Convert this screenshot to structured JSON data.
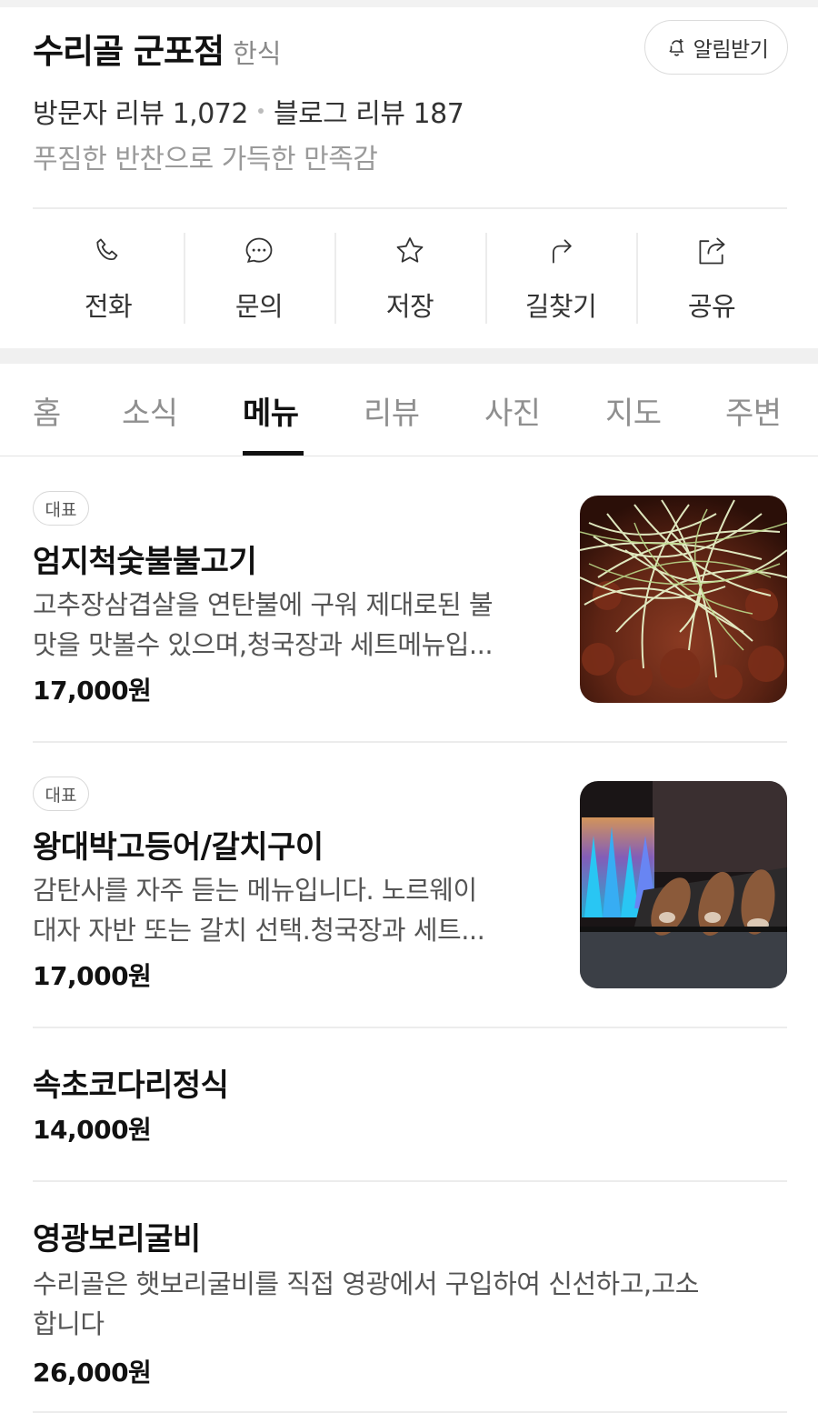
{
  "store": {
    "name": "수리골 군포점",
    "category": "한식",
    "alarm_label": "알림받기",
    "visitor_reviews": "방문자 리뷰 1,072",
    "blog_reviews": "블로그 리뷰 187",
    "tagline": "푸짐한 반찬으로 가득한 만족감"
  },
  "actions": [
    {
      "label": "전화",
      "icon": "phone-icon"
    },
    {
      "label": "문의",
      "icon": "chat-icon"
    },
    {
      "label": "저장",
      "icon": "star-icon"
    },
    {
      "label": "길찾기",
      "icon": "directions-icon"
    },
    {
      "label": "공유",
      "icon": "share-icon"
    }
  ],
  "tabs": [
    "홈",
    "소식",
    "메뉴",
    "리뷰",
    "사진",
    "지도",
    "주변"
  ],
  "active_tab": "메뉴",
  "menu": [
    {
      "badge": "대표",
      "name": "엄지척숯불불고기",
      "desc_line1": "고추장삼겹살을 연탄불에 구워 제대로된 불",
      "desc_line2": "맛을 맛볼수 있으며,청국장과 세트메뉴입...",
      "price": "17,000원",
      "image": "grilled-pork-with-green-onion"
    },
    {
      "badge": "대표",
      "name": "왕대박고등어/갈치구이",
      "desc_line1": "감탄사를 자주 듣는 메뉴입니다. 노르웨이",
      "desc_line2": "대자 자반 또는 갈치 선택.청국장과 세트...",
      "price": "17,000원",
      "image": "grilled-fish-over-flame"
    },
    {
      "name": "속초코다리정식",
      "price": "14,000원"
    },
    {
      "name": "영광보리굴비",
      "desc_line1": "수리골은 햇보리굴비를 직접 영광에서 구입하여 신선하고,고소",
      "desc_line2": "합니다",
      "price": "26,000원"
    }
  ],
  "colors": {
    "text_primary": "#111111",
    "text_secondary": "#555555",
    "text_muted": "#8f8f8f",
    "divider": "#ececec",
    "band": "#f0f0f0"
  }
}
